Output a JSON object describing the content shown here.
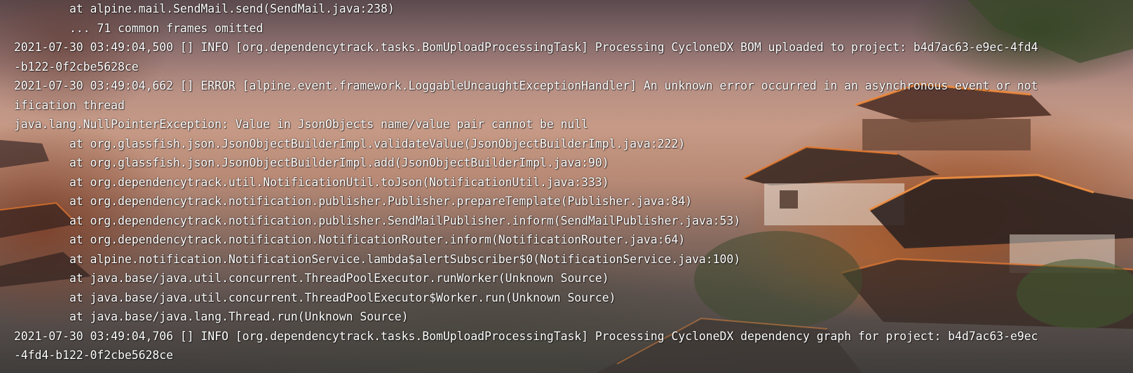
{
  "terminal": {
    "lines": [
      "        at alpine.mail.SendMail.send(SendMail.java:238)",
      "        ... 71 common frames omitted",
      "2021-07-30 03:49:04,500 [] INFO [org.dependencytrack.tasks.BomUploadProcessingTask] Processing CycloneDX BOM uploaded to project: b4d7ac63-e9ec-4fd4",
      "-b122-0f2cbe5628ce",
      "2021-07-30 03:49:04,662 [] ERROR [alpine.event.framework.LoggableUncaughtExceptionHandler] An unknown error occurred in an asynchronous event or not",
      "ification thread",
      "java.lang.NullPointerException: Value in JsonObjects name/value pair cannot be null",
      "        at org.glassfish.json.JsonObjectBuilderImpl.validateValue(JsonObjectBuilderImpl.java:222)",
      "        at org.glassfish.json.JsonObjectBuilderImpl.add(JsonObjectBuilderImpl.java:90)",
      "        at org.dependencytrack.util.NotificationUtil.toJson(NotificationUtil.java:333)",
      "        at org.dependencytrack.notification.publisher.Publisher.prepareTemplate(Publisher.java:84)",
      "        at org.dependencytrack.notification.publisher.SendMailPublisher.inform(SendMailPublisher.java:53)",
      "        at org.dependencytrack.notification.NotificationRouter.inform(NotificationRouter.java:64)",
      "        at alpine.notification.NotificationService.lambda$alertSubscriber$0(NotificationService.java:100)",
      "        at java.base/java.util.concurrent.ThreadPoolExecutor.runWorker(Unknown Source)",
      "        at java.base/java.util.concurrent.ThreadPoolExecutor$Worker.run(Unknown Source)",
      "        at java.base/java.lang.Thread.run(Unknown Source)",
      "2021-07-30 03:49:04,706 [] INFO [org.dependencytrack.tasks.BomUploadProcessingTask] Processing CycloneDX dependency graph for project: b4d7ac63-e9ec",
      "-4fd4-b122-0f2cbe5628ce"
    ]
  }
}
